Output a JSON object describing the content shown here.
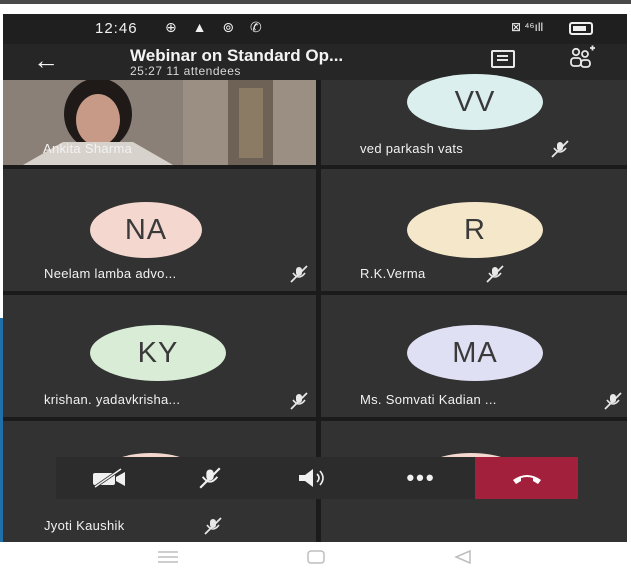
{
  "status": {
    "time": "12:46",
    "left_icons": "⊕ ▲ ⊚ ✆",
    "right_icons": "⊠ ⁴⁶ıll"
  },
  "header": {
    "back_icon": "arrow-left-icon",
    "title": "Webinar on Standard Op...",
    "subtitle": "25:27  11 attendees",
    "chat_icon": "chat-icon",
    "people_icon": "add-people-icon"
  },
  "participants": [
    {
      "name": "Ankita Sharma",
      "type": "video"
    },
    {
      "name": "ved parkash vats",
      "initials": "VV",
      "color": "#dcefef",
      "muted": true
    },
    {
      "name": "Neelam lamba advo...",
      "initials": "NA",
      "color": "#f4d7cf",
      "muted": true
    },
    {
      "name": "R.K.Verma",
      "initials": "R",
      "color": "#f5e7c9",
      "muted": true
    },
    {
      "name": "krishan. yadavkrisha...",
      "initials": "KY",
      "color": "#d8ecd6",
      "muted": true
    },
    {
      "name": "Ms. Somvati Kadian ...",
      "initials": "MA",
      "color": "#e0e0f4",
      "muted": true
    },
    {
      "name": "Jyoti Kaushik",
      "muted": true
    },
    {
      "name": ""
    }
  ],
  "controls": {
    "camera_icon": "camera-off-icon",
    "mic_icon": "mic-off-icon",
    "speaker_icon": "speaker-icon",
    "more_icon": "more-icon",
    "hangup_icon": "hang-up-icon",
    "hangup_color": "#a3203d"
  },
  "nav": {
    "menu_icon": "menu-icon",
    "home_icon": "home-icon",
    "back_icon": "back-triangle-icon"
  }
}
